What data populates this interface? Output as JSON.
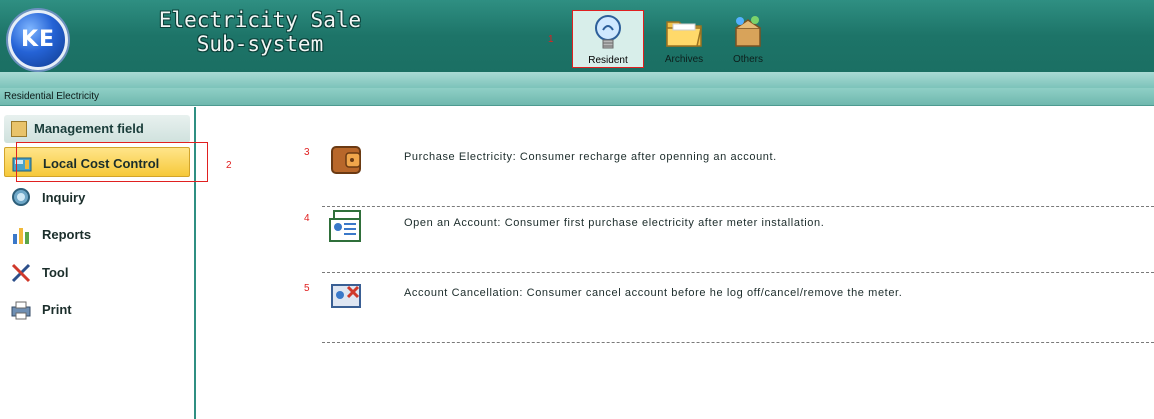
{
  "header": {
    "logo_text": "KE",
    "title_line1": "Electricity Sale",
    "title_line2": "Sub-system",
    "marker": "1"
  },
  "topnav": [
    {
      "label": "Resident",
      "icon": "lightbulb-icon",
      "active": true
    },
    {
      "label": "Archives",
      "icon": "folder-icon",
      "active": false
    },
    {
      "label": "Others",
      "icon": "box-icon",
      "active": false
    }
  ],
  "breadcrumb": "Residential Electricity",
  "sidebar": {
    "header_label": "Management field",
    "marker": "2",
    "items": [
      {
        "label": "Local Cost Control",
        "icon": "cashier-icon",
        "active": true
      },
      {
        "label": "Inquiry",
        "icon": "magnifier-icon",
        "active": false
      },
      {
        "label": "Reports",
        "icon": "bar-chart-icon",
        "active": false
      },
      {
        "label": "Tool",
        "icon": "tools-icon",
        "active": false
      },
      {
        "label": "Print",
        "icon": "printer-icon",
        "active": false
      }
    ]
  },
  "main": {
    "entries": [
      {
        "marker": "3",
        "icon": "wallet-icon",
        "text": "Purchase Electricity: Consumer recharge after openning an account."
      },
      {
        "marker": "4",
        "icon": "id-card-icon",
        "text": "Open an Account: Consumer first purchase electricity after meter installation."
      },
      {
        "marker": "5",
        "icon": "cancel-account-icon",
        "text": "Account Cancellation: Consumer cancel account before he log off/cancel/remove the meter."
      }
    ]
  },
  "colors": {
    "header_teal": "#1d7468",
    "active_yellow": "#f6c93a",
    "annotation_red": "#e02020"
  }
}
